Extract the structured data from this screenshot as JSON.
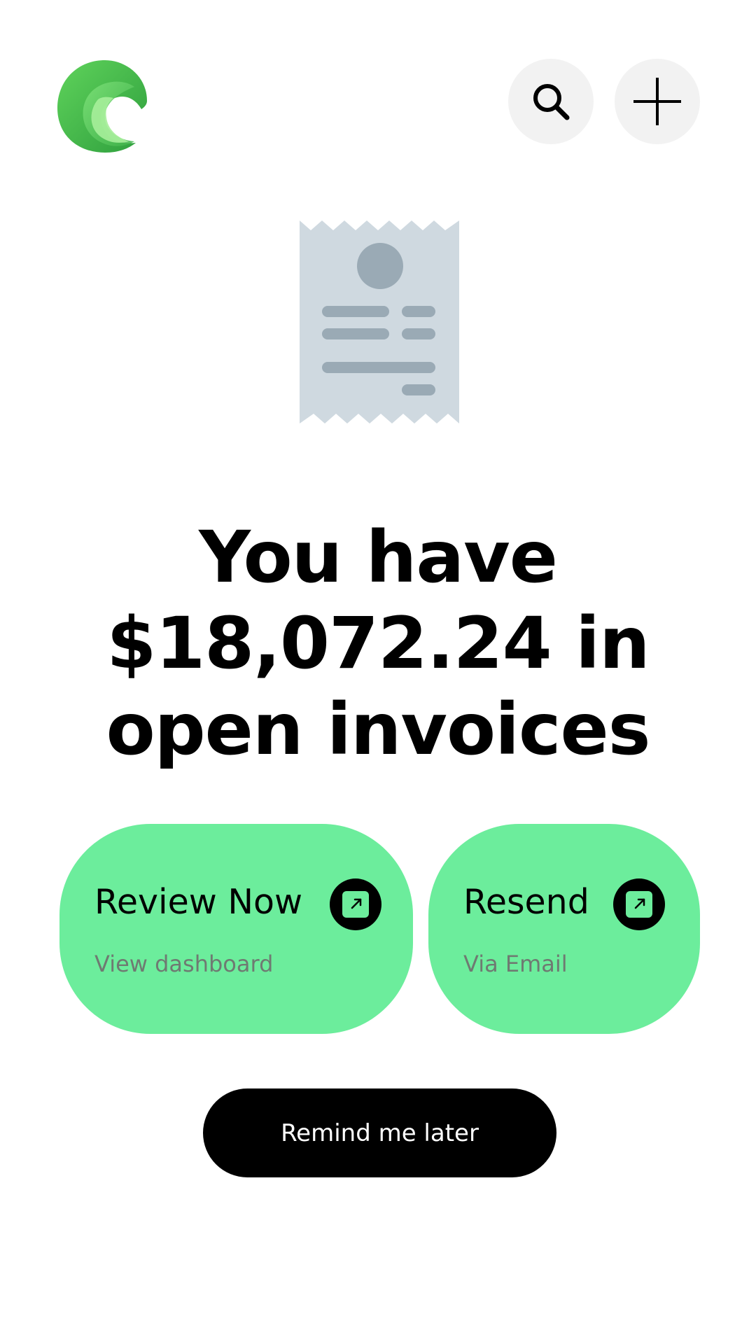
{
  "header": {
    "logo_icon": "wave-logo",
    "search_icon": "search-icon",
    "add_icon": "plus-icon"
  },
  "illustration": {
    "icon": "receipt-icon"
  },
  "headline": {
    "line1": "You have",
    "line2": "$18,072.24 in",
    "line3": "open invoices"
  },
  "actions": [
    {
      "title": "Review Now",
      "subtitle": "View dashboard",
      "icon": "external-arrow-icon"
    },
    {
      "title": "Resend",
      "subtitle": "Via Email",
      "icon": "external-arrow-icon"
    }
  ],
  "remind": {
    "label": "Remind me later"
  },
  "colors": {
    "accent_green": "#6ced9c",
    "button_dark": "#000000",
    "icon_bg": "#f2f2f2",
    "receipt_paper": "#cfd9e0",
    "receipt_ink": "#9aaab5"
  }
}
